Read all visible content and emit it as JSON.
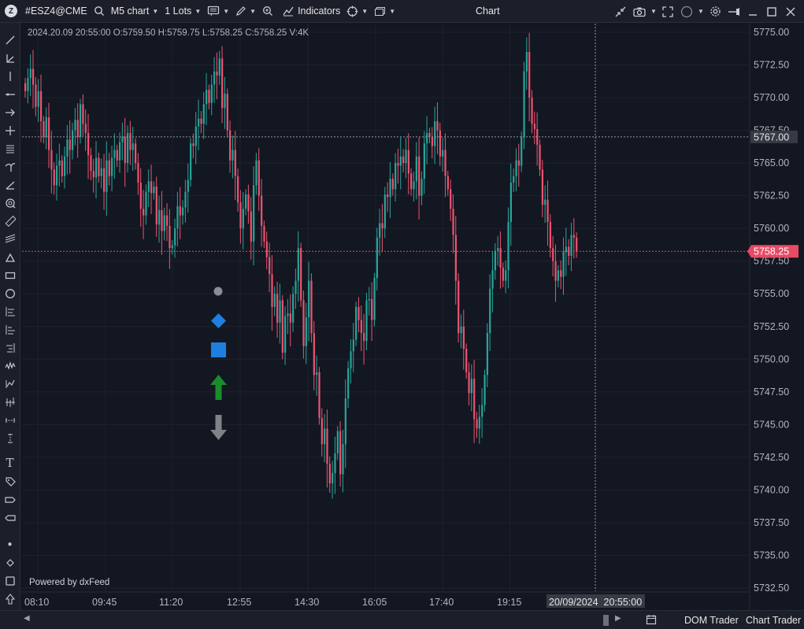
{
  "toolbar": {
    "symbol": "#ESZ4@CME",
    "timeframe": "M5 chart",
    "lots": "1 Lots",
    "indicators": "Indicators",
    "window_title": "Chart"
  },
  "legend": {
    "ohlc": "2024.20.09 20:55:00 O:5759.50 H:5759.75 L:5758.25 C:5758.25 V:4K"
  },
  "powered_by": "Powered by dxFeed",
  "price_axis": {
    "ticks": [
      "5775.00",
      "5772.50",
      "5770.00",
      "5767.50",
      "5765.00",
      "5762.50",
      "5760.00",
      "5757.50",
      "5755.00",
      "5752.50",
      "5750.00",
      "5747.50",
      "5745.00",
      "5742.50",
      "5740.00",
      "5737.50",
      "5735.00",
      "5732.50"
    ],
    "crosshair_price": "5767.00",
    "last_price": "5758.25",
    "last_price_color": "#e84a66"
  },
  "time_axis": {
    "ticks": [
      "08:10",
      "09:45",
      "11:20",
      "12:55",
      "14:30",
      "16:05",
      "17:40",
      "19:15"
    ],
    "crosshair_time": "20/09/2024  20:55:00"
  },
  "bottom": {
    "dom_trader": "DOM Trader",
    "chart_trader": "Chart Trader"
  },
  "colors": {
    "up": "#26a69a",
    "down": "#ef5370",
    "background": "#131722",
    "grid": "#1e2230"
  },
  "chart_data": {
    "type": "candlestick",
    "symbol": "#ESZ4@CME",
    "interval": "M5",
    "ylim": [
      5731.5,
      5776
    ],
    "closes": [
      5770.5,
      5771.5,
      5772.2,
      5771.0,
      5769.3,
      5770.5,
      5768.2,
      5767.0,
      5768.5,
      5766.0,
      5764.5,
      5763.3,
      5764.8,
      5765.2,
      5764.0,
      5765.5,
      5766.8,
      5766.0,
      5767.5,
      5768.3,
      5767.0,
      5769.5,
      5768.0,
      5767.3,
      5765.6,
      5764.4,
      5763.9,
      5765.4,
      5764.0,
      5764.6,
      5762.8,
      5765.2,
      5764.0,
      5765.4,
      5766.0,
      5765.2,
      5766.6,
      5767.0,
      5765.0,
      5767.3,
      5766.0,
      5766.5,
      5765.0,
      5763.5,
      5761.5,
      5761.0,
      5762.8,
      5763.6,
      5762.7,
      5763.2,
      5760.3,
      5761.4,
      5759.8,
      5761.0,
      5760.2,
      5758.5,
      5758.7,
      5760.0,
      5761.7,
      5761.0,
      5761.6,
      5762.8,
      5763.7,
      5766.5,
      5766.3,
      5767.8,
      5768.4,
      5768.0,
      5769.5,
      5770.6,
      5769.6,
      5771.0,
      5772.0,
      5771.7,
      5773.0,
      5769.2,
      5770.3,
      5767.5,
      5765.2,
      5766.0,
      5764.0,
      5762.0,
      5760.0,
      5761.5,
      5762.6,
      5761.3,
      5759.0,
      5763.3,
      5765.2,
      5762.5,
      5760.2,
      5759.0,
      5757.8,
      5756.5,
      5754.0,
      5755.0,
      5752.8,
      5754.5,
      5750.5,
      5753.3,
      5753.5,
      5752.8,
      5755.0,
      5756.0,
      5758.5,
      5754.5,
      5751.0,
      5753.2,
      5756.0,
      5752.0,
      5748.8,
      5749.0,
      5745.5,
      5743.5,
      5744.7,
      5742.0,
      5740.5,
      5741.3,
      5742.8,
      5744.5,
      5741.2,
      5743.5,
      5747.0,
      5749.3,
      5750.6,
      5751.5,
      5754.0,
      5753.0,
      5752.0,
      5751.4,
      5754.5,
      5754.6,
      5753.0,
      5756.2,
      5759.3,
      5760.4,
      5760.0,
      5762.6,
      5762.4,
      5763.8,
      5763.0,
      5765.0,
      5764.8,
      5765.5,
      5765.0,
      5766.0,
      5764.2,
      5763.0,
      5763.6,
      5765.5,
      5762.5,
      5763.8,
      5766.5,
      5767.3,
      5767.0,
      5766.3,
      5768.2,
      5767.5,
      5765.5,
      5766.0,
      5764.0,
      5763.0,
      5761.5,
      5759.5,
      5756.0,
      5752.0,
      5752.5,
      5750.8,
      5749.0,
      5747.4,
      5748.5,
      5745.4,
      5744.7,
      5745.6,
      5746.5,
      5748.8,
      5752.0,
      5755.4,
      5756.8,
      5758.3,
      5758.5,
      5757.0,
      5756.0,
      5756.8,
      5760.5,
      5763.5,
      5764.0,
      5765.2,
      5764.8,
      5767.0,
      5772.0,
      5773.5,
      5770.0,
      5768.0,
      5767.6,
      5766.4,
      5764.5,
      5761.8,
      5762.2,
      5760.5,
      5758.5,
      5757.5,
      5756.0,
      5756.8,
      5756.3,
      5758.2,
      5758.6,
      5757.9,
      5759.5,
      5759.3,
      5758.25
    ],
    "candle_count": 214,
    "last": {
      "open": 5759.5,
      "high": 5759.75,
      "low": 5758.25,
      "close": 5758.25,
      "volume": "4K",
      "time": "2024.20.09 20:55:00"
    },
    "crosshair": {
      "price": 5767.0,
      "time": "20/09/2024 20:55:00"
    },
    "markers": [
      "circle-gray",
      "diamond-blue",
      "square-blue",
      "arrow-up-green",
      "arrow-down-gray"
    ]
  }
}
